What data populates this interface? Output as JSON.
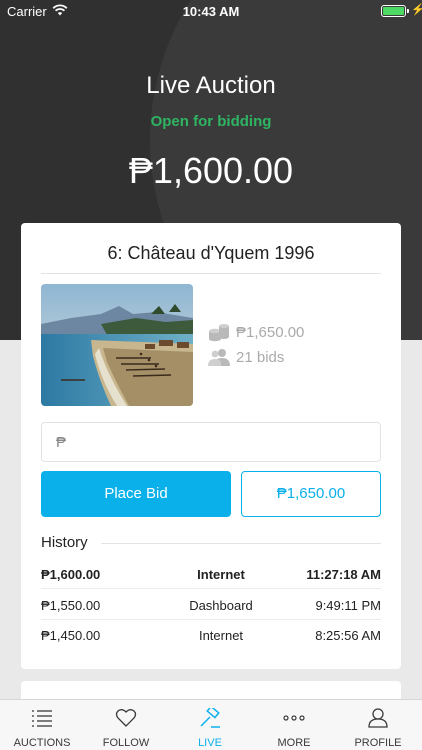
{
  "status_bar": {
    "carrier": "Carrier",
    "time": "10:43 AM"
  },
  "header": {
    "title": "Live Auction",
    "status": "Open for bidding",
    "current_price": "₱1,600.00"
  },
  "lot": {
    "title": "6: Château d'Yquem 1996",
    "image_alt": "Beach painting",
    "next_bid": "₱1,650.00",
    "bids": "21 bids"
  },
  "bid_form": {
    "currency_symbol": "₱",
    "input_value": "",
    "place_bid_label": "Place Bid",
    "quick_bid_label": "₱1,650.00"
  },
  "history": {
    "label": "History",
    "rows": [
      {
        "amount": "₱1,600.00",
        "source": "Internet",
        "time": "11:27:18 AM"
      },
      {
        "amount": "₱1,550.00",
        "source": "Dashboard",
        "time": "9:49:11 PM"
      },
      {
        "amount": "₱1,450.00",
        "source": "Internet",
        "time": "8:25:56 AM"
      }
    ]
  },
  "tabbar": {
    "active": "LIVE",
    "tabs": [
      {
        "label": "AUCTIONS",
        "icon": "list-icon"
      },
      {
        "label": "FOLLOW",
        "icon": "heart-icon"
      },
      {
        "label": "LIVE",
        "icon": "gavel-icon"
      },
      {
        "label": "MORE",
        "icon": "more-icon"
      },
      {
        "label": "PROFILE",
        "icon": "user-icon"
      }
    ]
  },
  "colors": {
    "accent": "#0ab0ea",
    "success": "#2fb463",
    "header_bg": "#303030"
  }
}
